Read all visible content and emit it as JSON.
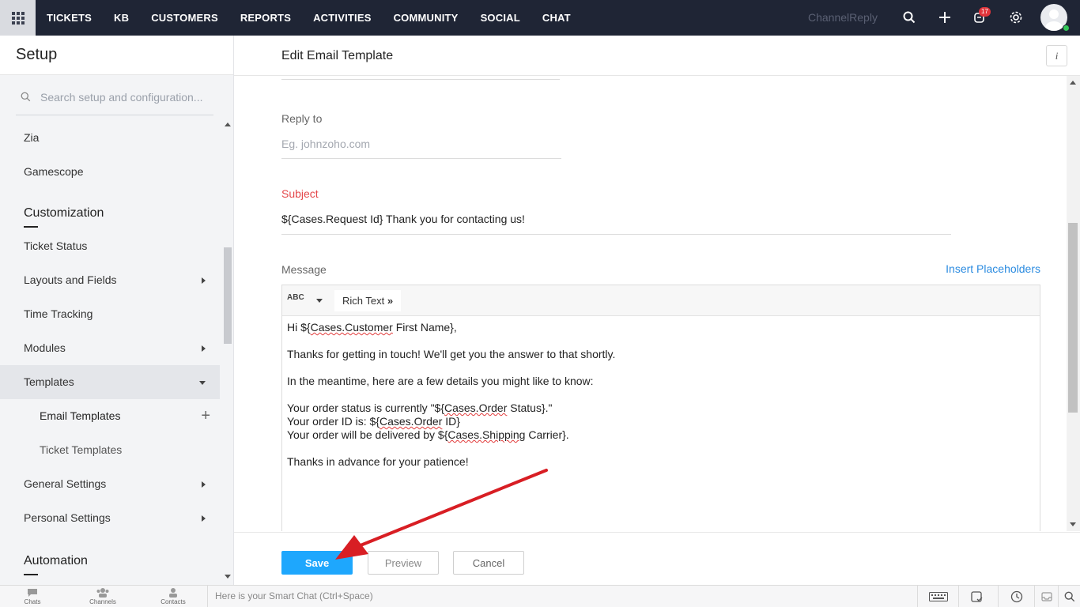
{
  "topnav": {
    "items": [
      "TICKETS",
      "KB",
      "CUSTOMERS",
      "REPORTS",
      "ACTIVITIES",
      "COMMUNITY",
      "SOCIAL",
      "CHAT"
    ],
    "brand": "ChannelReply",
    "notification_count": "17"
  },
  "sidebar": {
    "title": "Setup",
    "search_placeholder": "Search setup and configuration...",
    "items_top": [
      "Zia",
      "Gamescope"
    ],
    "section_customization": "Customization",
    "customization_items": [
      {
        "label": "Ticket Status",
        "has_arrow": false
      },
      {
        "label": "Layouts and Fields",
        "has_arrow": true
      },
      {
        "label": "Time Tracking",
        "has_arrow": false
      },
      {
        "label": "Modules",
        "has_arrow": true
      },
      {
        "label": "Templates",
        "has_arrow": true,
        "expanded": true
      },
      {
        "label": "Email Templates",
        "sub": true,
        "has_plus": true
      },
      {
        "label": "Ticket Templates",
        "sub": true
      },
      {
        "label": "General Settings",
        "has_arrow": true
      },
      {
        "label": "Personal Settings",
        "has_arrow": true
      }
    ],
    "section_automation": "Automation"
  },
  "main": {
    "title": "Edit Email Template",
    "reply_to_label": "Reply to",
    "reply_to_placeholder": "Eg. johnzoho.com",
    "subject_label": "Subject",
    "subject_value": "${Cases.Request Id} Thank you for contacting us!",
    "message_label": "Message",
    "insert_placeholders": "Insert Placeholders",
    "toolbar": {
      "spellcheck": "ABC",
      "rich_text": "Rich Text"
    },
    "message_lines": {
      "l1a": "Hi ${",
      "l1b": "Cases.Customer",
      "l1c": " First Name},",
      "l2": "Thanks for getting in touch! We'll get you the answer to that shortly.",
      "l3": "In the meantime, here are a few details you might like to know:",
      "l4a": "Your order status is currently \"${",
      "l4b": "Cases.Order",
      "l4c": " Status}.\"",
      "l5a": "Your order ID is: ${",
      "l5b": "Cases.Order",
      "l5c": " ID}",
      "l6a": "Your order will be delivered by ${",
      "l6b": "Cases.Shipping",
      "l6c": " Carrier}.",
      "l7": "Thanks in advance for your patience!"
    },
    "buttons": {
      "save": "Save",
      "preview": "Preview",
      "cancel": "Cancel"
    }
  },
  "bottombar": {
    "items": [
      "Chats",
      "Channels",
      "Contacts"
    ],
    "smart_chat_placeholder": "Here is your Smart Chat (Ctrl+Space)"
  },
  "colors": {
    "topbar": "#1f2535",
    "accent": "#1ea7fd",
    "link": "#2b8be0",
    "subject_label": "#e4474a",
    "annotation_arrow": "#d81e24"
  }
}
